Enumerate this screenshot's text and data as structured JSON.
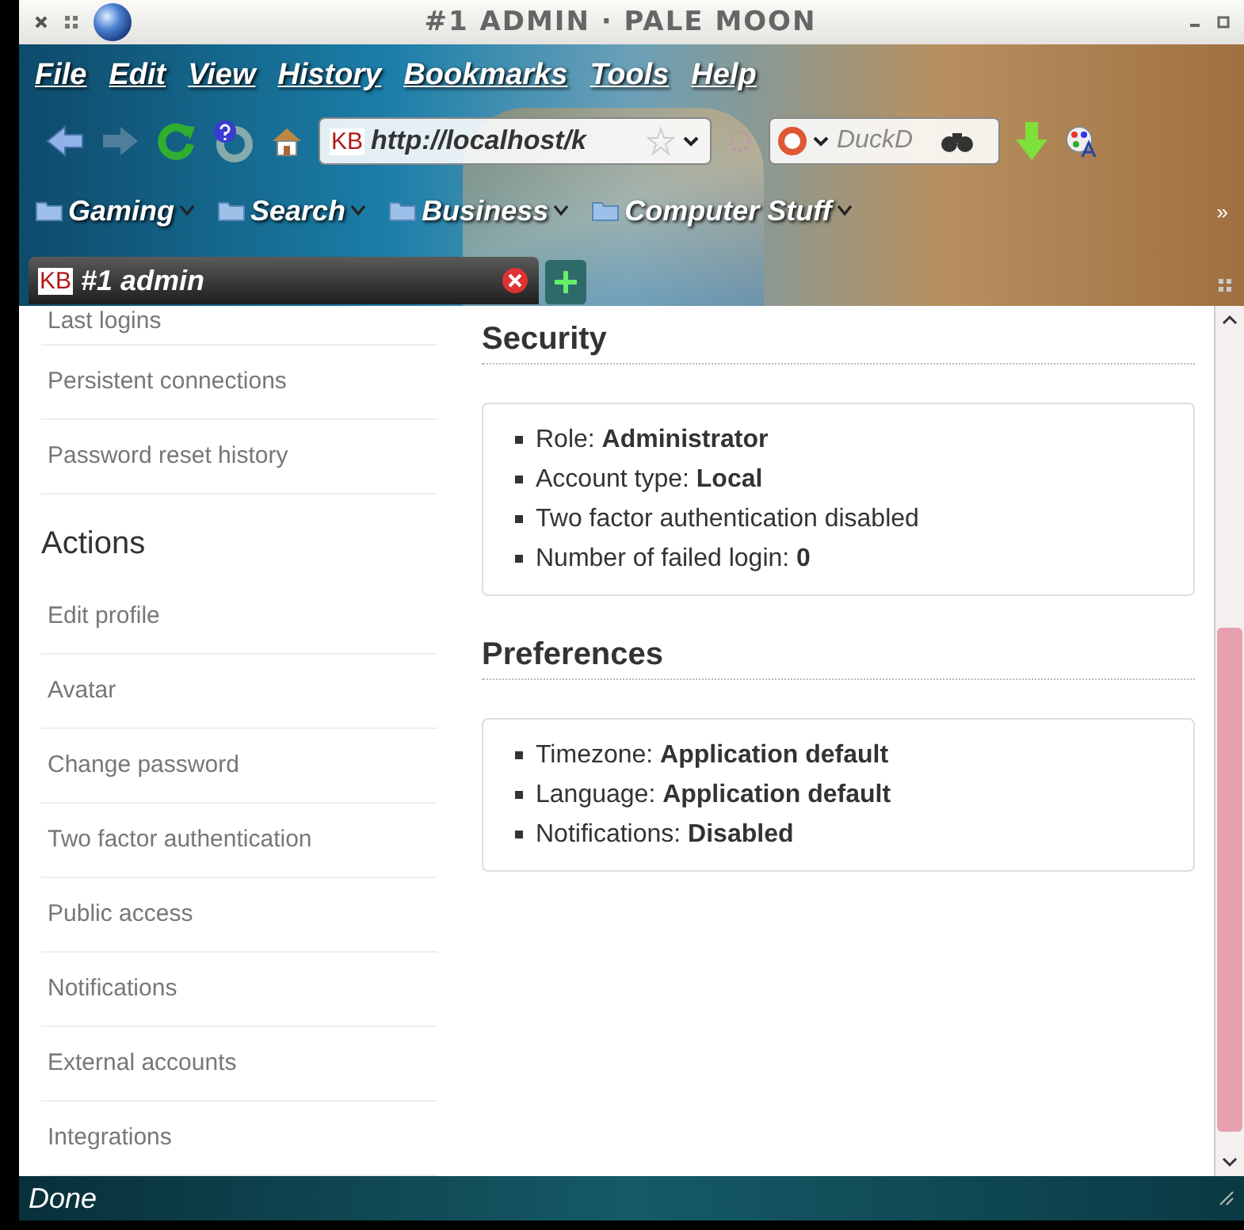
{
  "window": {
    "title": "#1 ADMIN · PALE MOON"
  },
  "menu": [
    "File",
    "Edit",
    "View",
    "History",
    "Bookmarks",
    "Tools",
    "Help"
  ],
  "toolbar": {
    "favicon": "KB",
    "url": "http://localhost/k",
    "search_placeholder": "DuckD"
  },
  "bookmarks": [
    {
      "label": "Gaming"
    },
    {
      "label": "Search"
    },
    {
      "label": "Business"
    },
    {
      "label": "Computer Stuff"
    }
  ],
  "overflow": "»",
  "tabs": [
    {
      "label": "#1 admin",
      "favicon": "KB",
      "selected": true
    }
  ],
  "sidebar": [
    {
      "kind": "item",
      "label": "Last logins"
    },
    {
      "kind": "item",
      "label": "Persistent connections"
    },
    {
      "kind": "item",
      "label": "Password reset history"
    },
    {
      "kind": "heading",
      "label": "Actions"
    },
    {
      "kind": "item",
      "label": "Edit profile"
    },
    {
      "kind": "item",
      "label": "Avatar"
    },
    {
      "kind": "item",
      "label": "Change password"
    },
    {
      "kind": "item",
      "label": "Two factor authentication"
    },
    {
      "kind": "item",
      "label": "Public access"
    },
    {
      "kind": "item",
      "label": "Notifications"
    },
    {
      "kind": "item",
      "label": "External accounts"
    },
    {
      "kind": "item",
      "label": "Integrations"
    }
  ],
  "sections": [
    {
      "title": "Security",
      "items": [
        "Role: **Administrator**",
        "Account type: **Local**",
        "Two factor authentication disabled",
        "Number of failed login: **0**"
      ]
    },
    {
      "title": "Preferences",
      "items": [
        "Timezone: **Application default**",
        "Language: **Application default**",
        "Notifications: **Disabled**"
      ]
    }
  ],
  "status_bar": "Done"
}
